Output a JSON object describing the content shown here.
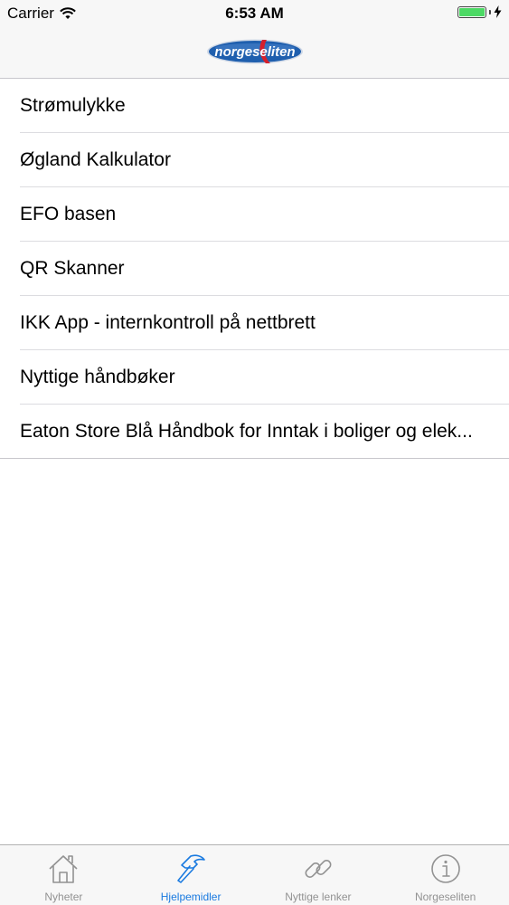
{
  "status_bar": {
    "carrier": "Carrier",
    "time": "6:53 AM",
    "battery_level": 1.0,
    "battery_color": "#4cd964"
  },
  "nav_bar": {
    "logo_text": "norgeseliten",
    "logo_colors": {
      "blue": "#1f5fae",
      "red": "#d6202b"
    }
  },
  "list": {
    "items": [
      {
        "label": "Strømulykke"
      },
      {
        "label": "Øgland Kalkulator"
      },
      {
        "label": "EFO basen"
      },
      {
        "label": "QR Skanner"
      },
      {
        "label": "IKK App - internkontroll på nettbrett"
      },
      {
        "label": "Nyttige håndbøker"
      },
      {
        "label": "Eaton Store Blå Håndbok for Inntak i boliger og elek..."
      }
    ]
  },
  "tab_bar": {
    "active_color": "#1a7ae0",
    "inactive_color": "#929292",
    "tabs": [
      {
        "label": "Nyheter",
        "icon": "house-icon",
        "active": false
      },
      {
        "label": "Hjelpemidler",
        "icon": "hammer-icon",
        "active": true
      },
      {
        "label": "Nyttige lenker",
        "icon": "link-icon",
        "active": false
      },
      {
        "label": "Norgeseliten",
        "icon": "info-icon",
        "active": false
      }
    ]
  }
}
